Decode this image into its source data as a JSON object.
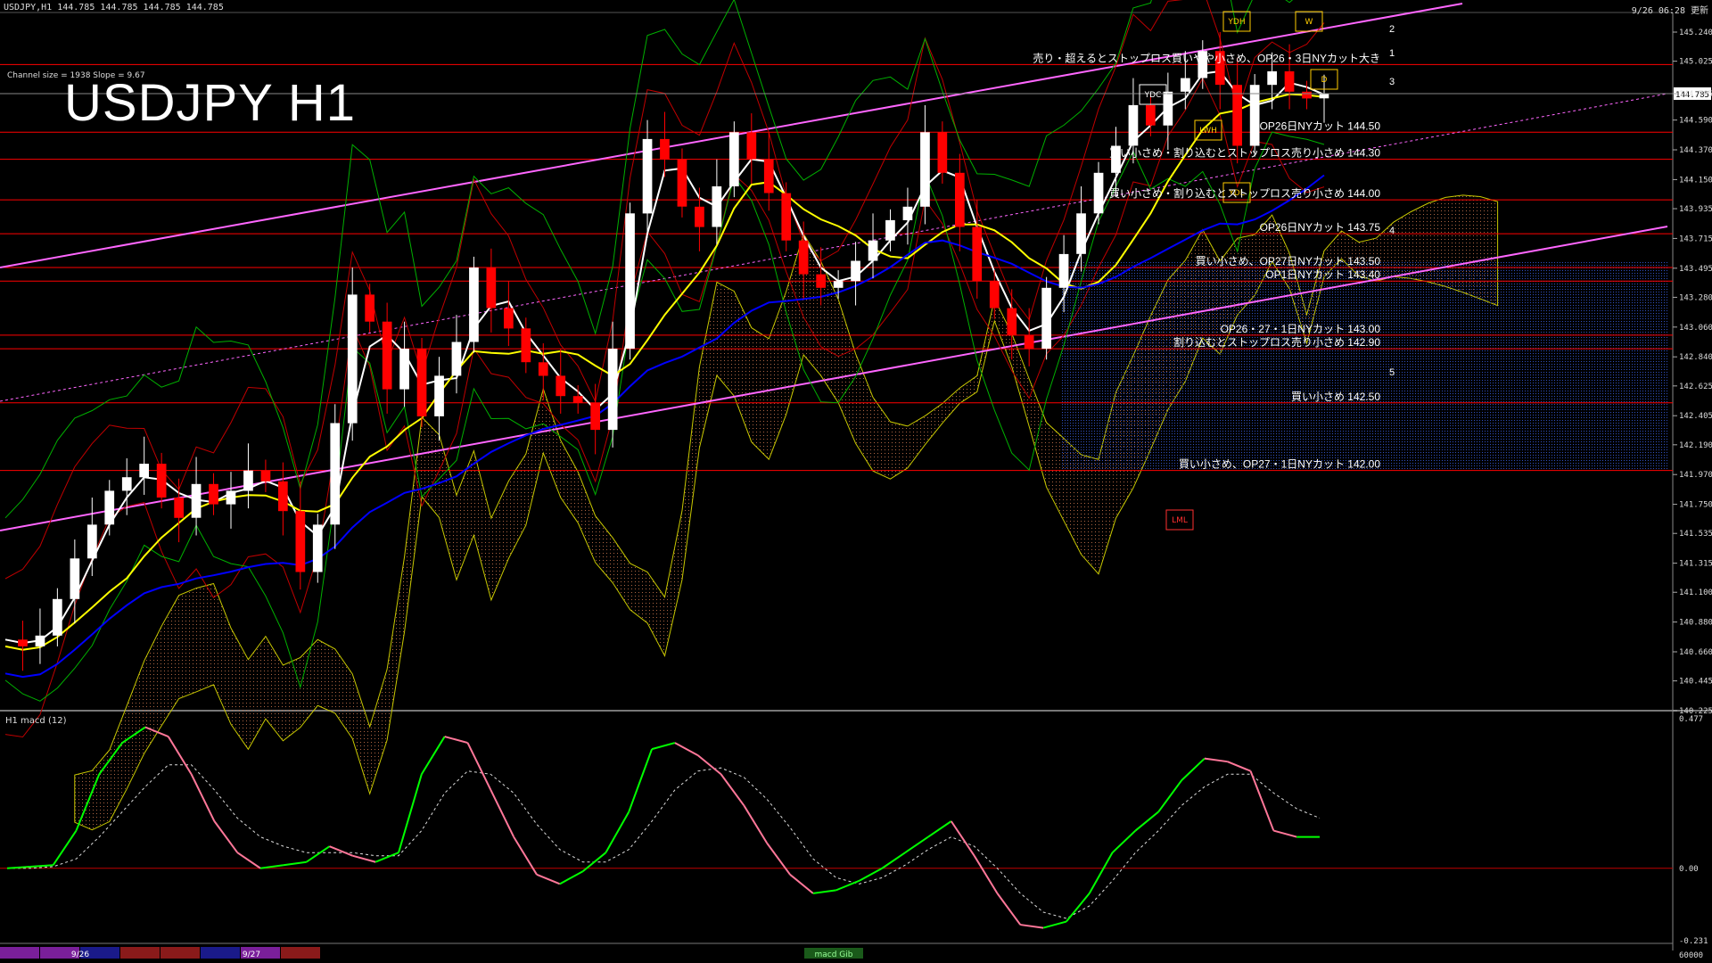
{
  "header": {
    "symbol_info": "USDJPY,H1  144.785 144.785 144.785 144.785",
    "datetime": "9/26 06:28 更新"
  },
  "title": "USDJPY H1",
  "channel_info": "Channel size = 1938 Slope = 9.67",
  "subwindow_label": "H1  macd (12)",
  "macd_badge": "macd Gib",
  "bottom_right_value": "60000",
  "bottom_dates": [
    "9/26",
    "9/27"
  ],
  "colors": {
    "background": "#000000",
    "bull_candle": "#ffffff",
    "bear_candle": "#ff0000",
    "ma_fast": "#ffffff",
    "ma_mid": "#ffff00",
    "ma_slow": "#0000ff",
    "channel": "#ff66ff",
    "levels": "#ff0000",
    "macd_up": "#00ff00",
    "macd_down": "#ff7799"
  },
  "chart_data": [
    {
      "type": "candlestick",
      "title": "USDJPY H1",
      "yticks": [
        "145.240",
        "145.025",
        "144.785",
        "144.590",
        "144.370",
        "144.150",
        "143.935",
        "143.715",
        "143.495",
        "143.280",
        "143.060",
        "142.840",
        "142.625",
        "142.405",
        "142.190",
        "141.970",
        "141.750",
        "141.535",
        "141.315",
        "141.100",
        "140.880",
        "140.660",
        "140.445",
        "140.225"
      ],
      "ylim": [
        140.225,
        145.385
      ],
      "current_price": 144.785,
      "close_path": [
        140.75,
        140.7,
        140.78,
        141.05,
        141.35,
        141.6,
        141.85,
        141.95,
        142.05,
        141.8,
        141.65,
        141.9,
        141.75,
        141.85,
        142.0,
        141.92,
        141.7,
        141.25,
        141.6,
        142.35,
        143.3,
        143.1,
        142.6,
        142.9,
        142.4,
        142.7,
        142.95,
        143.5,
        143.2,
        143.05,
        142.8,
        142.7,
        142.55,
        142.5,
        142.3,
        142.9,
        143.9,
        144.45,
        144.3,
        143.95,
        143.8,
        144.1,
        144.5,
        144.3,
        144.05,
        143.7,
        143.45,
        143.35,
        143.4,
        143.55,
        143.7,
        143.85,
        143.95,
        144.5,
        144.2,
        143.8,
        143.4,
        143.2,
        143.0,
        142.9,
        143.35,
        143.6,
        143.9,
        144.2,
        144.4,
        144.7,
        144.55,
        144.8,
        144.9,
        145.1,
        144.85,
        144.4,
        144.85,
        144.95,
        144.8,
        144.75,
        144.785
      ],
      "levels": [
        {
          "price": 145.0,
          "label": "売り・超えるとストップロス買いやや小さめ、OP26・3日NYカット大き"
        },
        {
          "price": 144.5,
          "label": "OP26日NYカット 144.50"
        },
        {
          "price": 144.3,
          "label": "買い小さめ・割り込むとストップロス売り小さめ 144.30"
        },
        {
          "price": 144.0,
          "label": "買い小さめ・割り込むとストップロス売り小さめ 144.00"
        },
        {
          "price": 143.75,
          "label": "OP26日NYカット 143.75"
        },
        {
          "price": 143.5,
          "label": "買い小さめ、OP27日NYカット 143.50"
        },
        {
          "price": 143.4,
          "label": "OP1日NYカット 143.40"
        },
        {
          "price": 143.0,
          "label": "OP26・27・1日NYカット 143.00"
        },
        {
          "price": 142.9,
          "label": "割り込むとストップロス売り小さめ 142.90"
        },
        {
          "price": 142.5,
          "label": "買い小さめ 142.50"
        },
        {
          "price": 142.0,
          "label": "買い小さめ、OP27・1日NYカット 142.00"
        }
      ],
      "scenario_marks": [
        "1",
        "2",
        "3",
        "4",
        "5"
      ],
      "boxes": [
        "YDH",
        "YDC",
        "LWH",
        "YDL",
        "LML",
        "W",
        "D"
      ]
    },
    {
      "type": "line",
      "title": "H1  macd (12)",
      "yticks": [
        "0.477",
        "0.00",
        "-0.231"
      ],
      "ylim": [
        -0.231,
        0.477
      ],
      "series": [
        {
          "values": [
            0.0,
            0.005,
            0.01,
            0.12,
            0.3,
            0.4,
            0.45,
            0.42,
            0.3,
            0.15,
            0.05,
            0.0,
            0.01,
            0.02,
            0.07,
            0.04,
            0.02,
            0.05,
            0.3,
            0.42,
            0.4,
            0.25,
            0.1,
            -0.02,
            -0.05,
            -0.01,
            0.05,
            0.18,
            0.38,
            0.4,
            0.36,
            0.3,
            0.2,
            0.08,
            -0.02,
            -0.08,
            -0.07,
            -0.04,
            0.0,
            0.05,
            0.1,
            0.15,
            0.04,
            -0.08,
            -0.18,
            -0.19,
            -0.17,
            -0.08,
            0.05,
            0.12,
            0.18,
            0.28,
            0.35,
            0.34,
            0.31,
            0.12,
            0.1,
            0.1
          ]
        },
        {
          "values": [
            0.0,
            0.0,
            0.005,
            0.03,
            0.1,
            0.18,
            0.26,
            0.33,
            0.33,
            0.25,
            0.16,
            0.1,
            0.07,
            0.05,
            0.05,
            0.05,
            0.04,
            0.04,
            0.12,
            0.24,
            0.31,
            0.3,
            0.24,
            0.14,
            0.06,
            0.02,
            0.02,
            0.06,
            0.15,
            0.25,
            0.31,
            0.32,
            0.29,
            0.22,
            0.13,
            0.03,
            -0.03,
            -0.05,
            -0.03,
            0.01,
            0.06,
            0.1,
            0.07,
            0.0,
            -0.08,
            -0.14,
            -0.16,
            -0.12,
            -0.04,
            0.05,
            0.12,
            0.2,
            0.26,
            0.3,
            0.3,
            0.24,
            0.19,
            0.16
          ]
        }
      ]
    }
  ]
}
